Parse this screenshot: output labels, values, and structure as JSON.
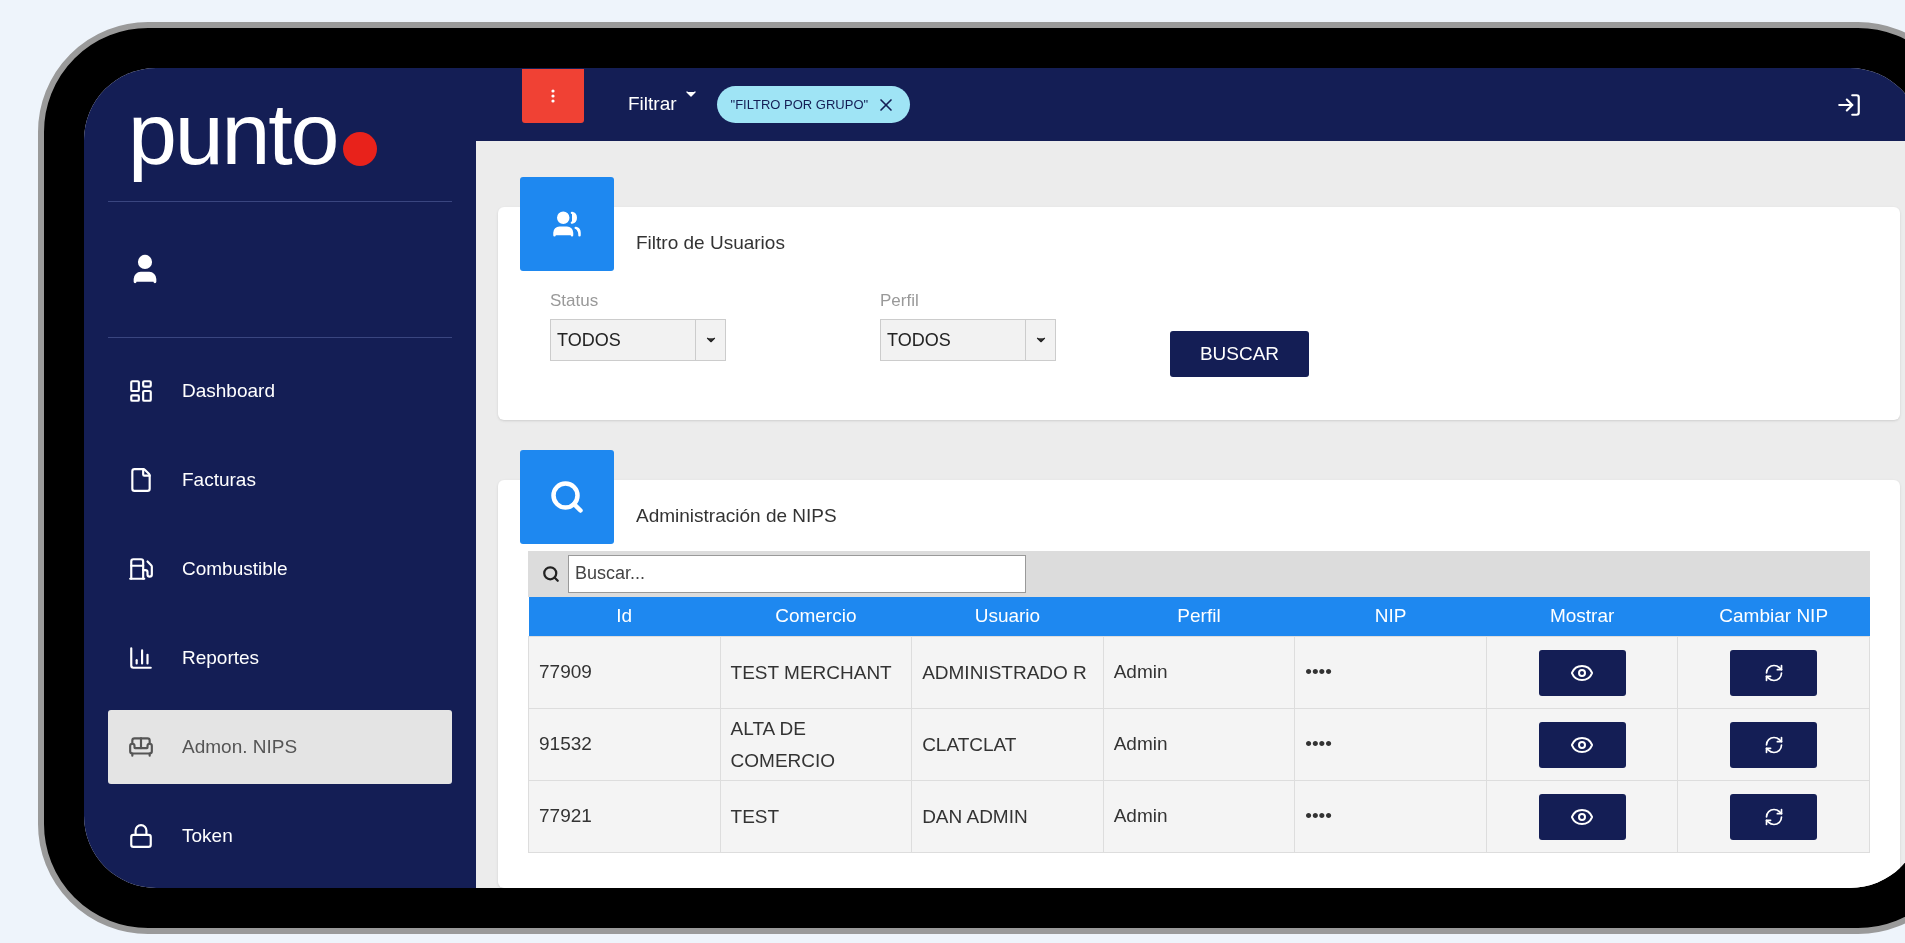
{
  "logo": {
    "text": "punto"
  },
  "sidebar": {
    "items": [
      {
        "label": "Dashboard",
        "selected": false
      },
      {
        "label": "Facturas",
        "selected": false
      },
      {
        "label": "Combustible",
        "selected": false
      },
      {
        "label": "Reportes",
        "selected": false
      },
      {
        "label": "Admon. NIPS",
        "selected": true
      },
      {
        "label": "Token",
        "selected": false
      }
    ]
  },
  "topbar": {
    "filter_label": "Filtrar",
    "chip": "\"FILTRO POR GRUPO\""
  },
  "filter_card": {
    "title": "Filtro de Usuarios",
    "fields": [
      {
        "label": "Status",
        "value": "TODOS"
      },
      {
        "label": "Perfil",
        "value": "TODOS"
      }
    ],
    "button": "BUSCAR"
  },
  "nips_card": {
    "title": "Administración de NIPS",
    "search": {
      "placeholder": "Buscar..."
    },
    "columns": [
      "Id",
      "Comercio",
      "Usuario",
      "Perfil",
      "NIP",
      "Mostrar",
      "Cambiar NIP"
    ],
    "rows": [
      {
        "id": "77909",
        "comercio": "TEST MERCHANT",
        "usuario": "ADMINISTRADO R",
        "perfil": "Admin",
        "nip": "••••"
      },
      {
        "id": "91532",
        "comercio": "ALTA DE COMERCIO",
        "usuario": "CLATCLAT",
        "perfil": "Admin",
        "nip": "••••"
      },
      {
        "id": "77921",
        "comercio": "TEST",
        "usuario": "DAN ADMIN",
        "perfil": "Admin",
        "nip": "••••"
      }
    ]
  }
}
